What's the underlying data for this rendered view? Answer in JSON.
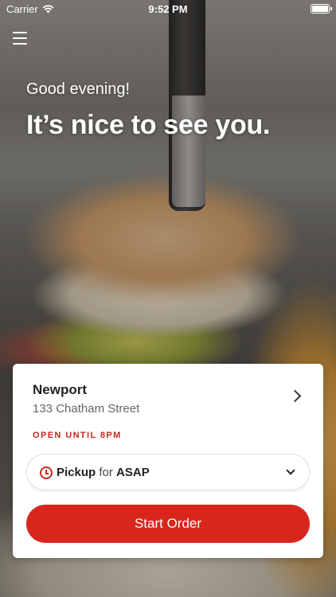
{
  "status_bar": {
    "carrier": "Carrier",
    "time": "9:52 PM",
    "battery_level": 1.0
  },
  "header": {
    "menu_icon": "hamburger-menu-icon"
  },
  "hero": {
    "greeting": "Good evening!",
    "headline": "It’s nice to see you."
  },
  "location_card": {
    "name": "Newport",
    "address": "133 Chatham Street",
    "hours_status": "OPEN UNTIL 8PM",
    "pickup": {
      "mode": "Pickup",
      "connector": "for",
      "time": "ASAP"
    },
    "start_button_label": "Start Order",
    "colors": {
      "accent": "#d9261c",
      "hours_text": "#c8281e"
    }
  }
}
